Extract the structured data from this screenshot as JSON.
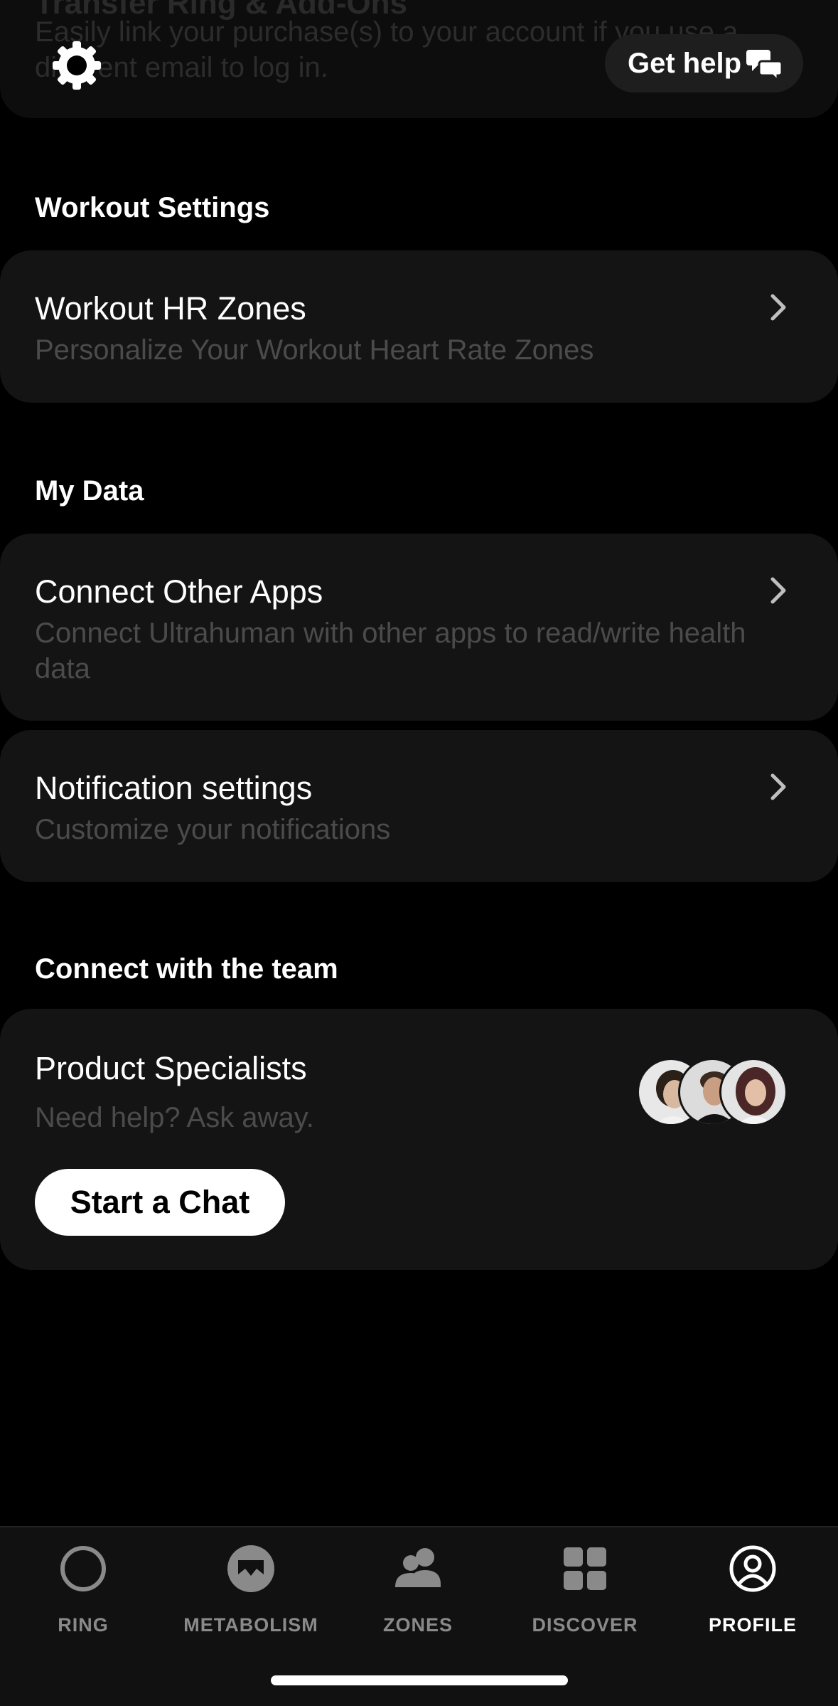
{
  "top_card": {
    "title": "Transfer Ring & Add-Ons",
    "subtitle": "Easily link your purchase(s) to your account if you use a different email to log in."
  },
  "header": {
    "get_help_label": "Get help"
  },
  "workout_settings": {
    "section_title": "Workout Settings",
    "hr_zones": {
      "title": "Workout HR Zones",
      "subtitle": "Personalize Your Workout Heart Rate Zones"
    }
  },
  "my_data": {
    "section_title": "My Data",
    "connect_apps": {
      "title": "Connect Other Apps",
      "subtitle": "Connect Ultrahuman with other apps to read/write health data"
    },
    "notifications": {
      "title": "Notification settings",
      "subtitle": "Customize your notifications"
    }
  },
  "team": {
    "section_title": "Connect with the team",
    "card_title": "Product Specialists",
    "card_subtitle": "Need help? Ask away.",
    "chat_button": "Start a Chat"
  },
  "tabs": [
    {
      "label": "RING",
      "icon": "ring-icon",
      "active": false
    },
    {
      "label": "METABOLISM",
      "icon": "metabolism-icon",
      "active": false
    },
    {
      "label": "ZONES",
      "icon": "zones-icon",
      "active": false
    },
    {
      "label": "DISCOVER",
      "icon": "discover-icon",
      "active": false
    },
    {
      "label": "PROFILE",
      "icon": "profile-icon",
      "active": true
    }
  ],
  "colors": {
    "background": "#000000",
    "card": "#141414",
    "muted_text": "#4b4b4b",
    "tab_inactive": "#8a8a8a"
  }
}
